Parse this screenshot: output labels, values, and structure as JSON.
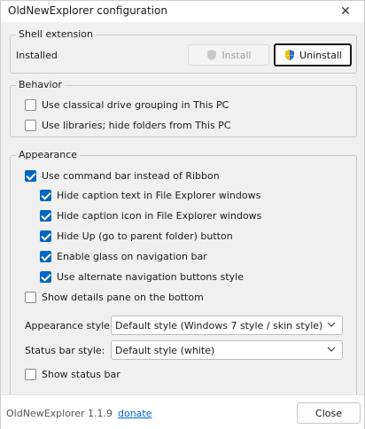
{
  "window": {
    "title": "OldNewExplorer configuration",
    "close_glyph": "✕"
  },
  "shell": {
    "legend": "Shell extension",
    "status": "Installed",
    "install_label": "Install",
    "uninstall_label": "Uninstall"
  },
  "behavior": {
    "legend": "Behavior",
    "items": [
      {
        "label": "Use classical drive grouping in This PC",
        "checked": false
      },
      {
        "label": "Use libraries; hide folders from This PC",
        "checked": false
      }
    ]
  },
  "appearance": {
    "legend": "Appearance",
    "command_bar": {
      "label": "Use command bar instead of Ribbon",
      "checked": true
    },
    "sub_items": [
      {
        "label": "Hide caption text in File Explorer windows",
        "checked": true
      },
      {
        "label": "Hide caption icon in File Explorer windows",
        "checked": true
      },
      {
        "label": "Hide Up (go to parent folder) button",
        "checked": true
      },
      {
        "label": "Enable glass on navigation bar",
        "checked": true
      },
      {
        "label": "Use alternate navigation buttons style",
        "checked": true
      }
    ],
    "details_pane": {
      "label": "Show details pane on the bottom",
      "checked": false
    },
    "appearance_style": {
      "label": "Appearance style:",
      "value": "Default style (Windows 7 style / skin style)"
    },
    "status_bar_style": {
      "label": "Status bar style:",
      "value": "Default style (white)"
    },
    "show_status_bar": {
      "label": "Show status bar",
      "checked": false
    }
  },
  "footer": {
    "version": "OldNewExplorer 1.1.9",
    "donate": "donate",
    "close_label": "Close"
  },
  "colors": {
    "accent": "#0067c0",
    "link": "#0066cc"
  }
}
